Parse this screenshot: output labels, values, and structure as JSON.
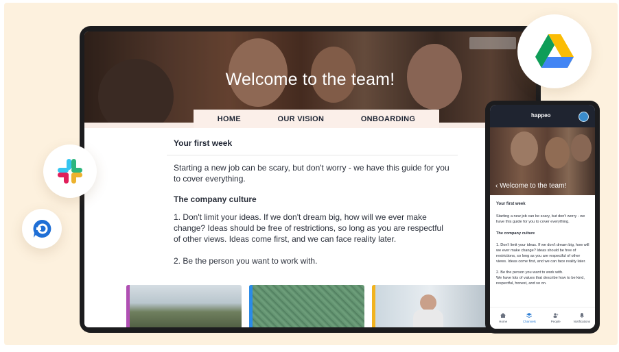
{
  "page": {
    "hero_title": "Welcome to the team!",
    "nav": [
      "HOME",
      "OUR VISION",
      "ONBOARDING"
    ],
    "section_heading": "Your first week",
    "intro": "Starting a new job can be scary, but don't worry - we have this guide for you to cover everything.",
    "culture_heading": "The company culture",
    "point1": "1. Don't limit your ideas. If we don't dream big, how will we ever make change? Ideas should be free of restrictions, so long as you are respectful of other views. Ideas come first, and we can face reality later.",
    "point2": "2. Be the person you want to work with."
  },
  "phone": {
    "brand": "happeo",
    "hero_title": "Welcome to the team!",
    "section_heading": "Your first week",
    "intro": "Starting a new job can be scary, but don't worry - we have this guide for you to cover everything.",
    "culture_heading": "The company culture",
    "point1": "1. Don't limit your ideas. If we don't dream big, how will we ever make change? Ideas should be free of restrictions, so long as you are respectful of other views. Ideas come first, and we can face reality later.",
    "point2": "2. Be the person you want to work with.",
    "point2_detail": "We have lots of values that describe how to be kind, respectful, honest, and so on.",
    "tabs": [
      "Home",
      "Channels",
      "People",
      "Notifications"
    ],
    "active_tab": "Channels"
  },
  "integrations": [
    "google-drive-icon",
    "slack-icon",
    "chat-app-icon"
  ],
  "colors": {
    "background": "#fdf1de",
    "nav_bg": "#fbefe9",
    "active_tab": "#2b7cd3",
    "thumb_accents": [
      "#b04fb3",
      "#2b8be8",
      "#f2b31e"
    ]
  }
}
